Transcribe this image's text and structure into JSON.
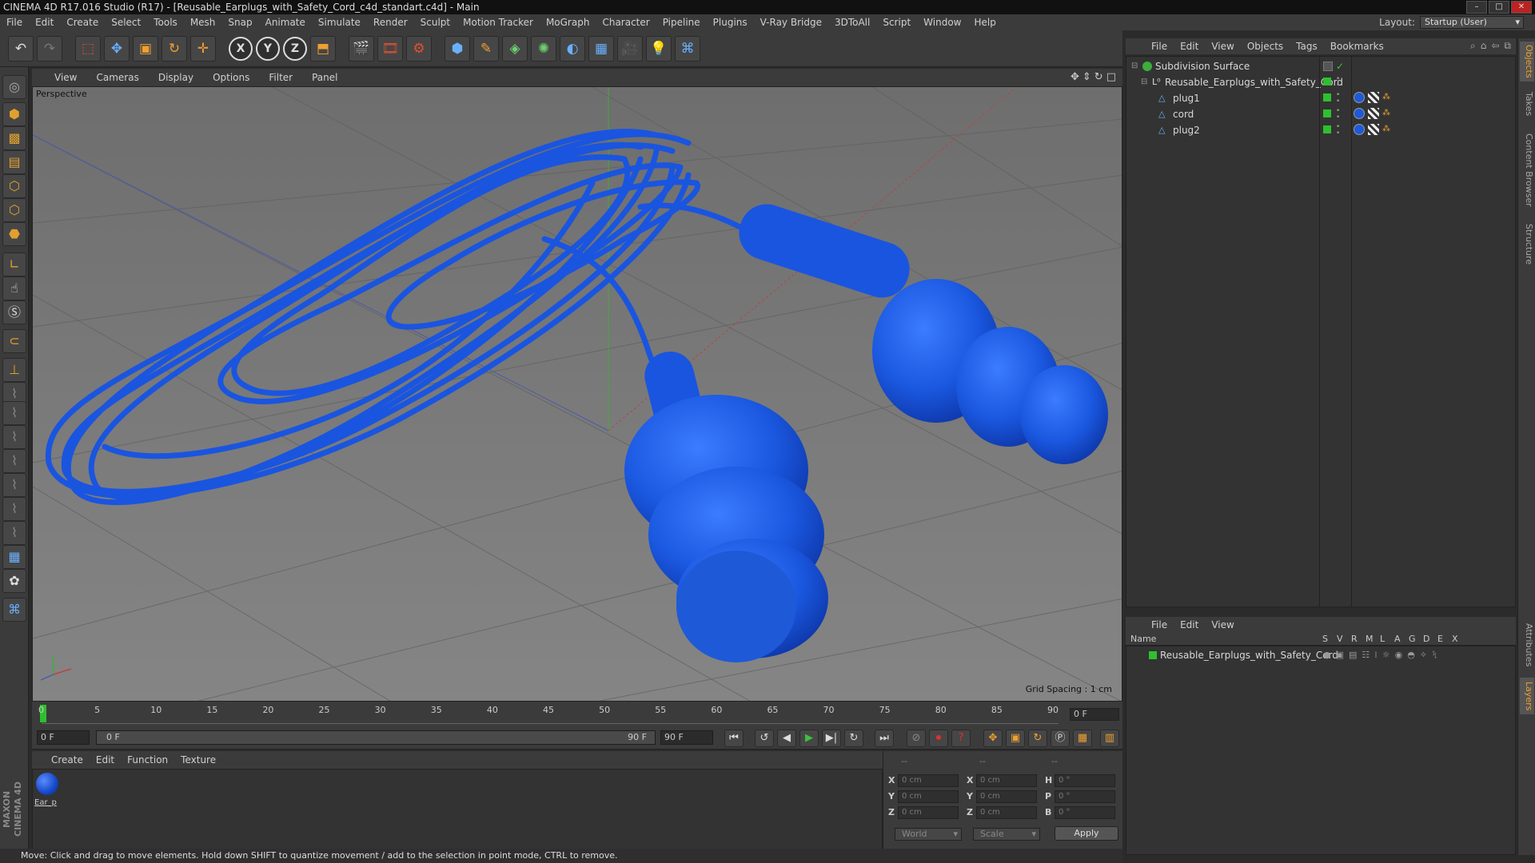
{
  "window": {
    "title": "CINEMA 4D R17.016 Studio (R17) - [Reusable_Earplugs_with_Safety_Cord_c4d_standart.c4d] - Main"
  },
  "menu": [
    "File",
    "Edit",
    "Create",
    "Select",
    "Tools",
    "Mesh",
    "Snap",
    "Animate",
    "Simulate",
    "Render",
    "Sculpt",
    "Motion Tracker",
    "MoGraph",
    "Character",
    "Pipeline",
    "Plugins",
    "V-Ray Bridge",
    "3DToAll",
    "Script",
    "Window",
    "Help"
  ],
  "layout": {
    "label": "Layout:",
    "value": "Startup (User)"
  },
  "toolbar": {
    "axis_x": "X",
    "axis_y": "Y",
    "axis_z": "Z"
  },
  "viewport": {
    "menu": [
      "View",
      "Cameras",
      "Display",
      "Options",
      "Filter",
      "Panel"
    ],
    "label": "Perspective",
    "grid_spacing": "Grid Spacing : 1 cm"
  },
  "timeline": {
    "ticks": [
      "0",
      "5",
      "10",
      "15",
      "20",
      "25",
      "30",
      "35",
      "40",
      "45",
      "50",
      "55",
      "60",
      "65",
      "70",
      "75",
      "80",
      "85",
      "90"
    ],
    "current_frame": "0 F"
  },
  "transport": {
    "start_field": "0 F",
    "range_start": "0 F",
    "range_end": "90 F",
    "end_field": "90 F"
  },
  "materials": {
    "menu": [
      "Create",
      "Edit",
      "Function",
      "Texture"
    ],
    "items": [
      {
        "label": "Ear_p"
      }
    ]
  },
  "coords": {
    "headers": [
      "--",
      "--",
      "--"
    ],
    "rows": [
      {
        "l1": "X",
        "v1": "0 cm",
        "l2": "X",
        "v2": "0 cm",
        "l3": "H",
        "v3": "0 °"
      },
      {
        "l1": "Y",
        "v1": "0 cm",
        "l2": "Y",
        "v2": "0 cm",
        "l3": "P",
        "v3": "0 °"
      },
      {
        "l1": "Z",
        "v1": "0 cm",
        "l2": "Z",
        "v2": "0 cm",
        "l3": "B",
        "v3": "0 °"
      }
    ],
    "mode1": "World",
    "mode2": "Scale",
    "apply": "Apply"
  },
  "status": "Move: Click and drag to move elements. Hold down SHIFT to quantize movement / add to the selection in point mode, CTRL to remove.",
  "objects": {
    "menu": [
      "File",
      "Edit",
      "View",
      "Objects",
      "Tags",
      "Bookmarks"
    ],
    "tree": [
      {
        "name": "Subdivision Surface",
        "indent": 0
      },
      {
        "name": "Reusable_Earplugs_with_Safety_Cord",
        "indent": 1
      },
      {
        "name": "plug1",
        "indent": 2
      },
      {
        "name": "cord",
        "indent": 2
      },
      {
        "name": "plug2",
        "indent": 2
      }
    ]
  },
  "layers": {
    "menu": [
      "File",
      "Edit",
      "View"
    ],
    "headers": [
      "Name",
      "S",
      "V",
      "R",
      "M",
      "L",
      "A",
      "G",
      "D",
      "E",
      "X"
    ],
    "items": [
      {
        "name": "Reusable_Earplugs_with_Safety_Cord"
      }
    ]
  },
  "side_tabs": [
    "Objects",
    "Takes",
    "Content Browser",
    "Structure",
    "Attributes",
    "Layers"
  ],
  "colors": {
    "accent": "#f0a030",
    "material": "#1e5ad8",
    "layer": "#2ec02e"
  }
}
